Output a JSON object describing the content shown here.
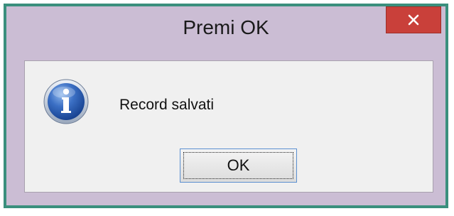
{
  "dialog": {
    "title": "Premi OK",
    "message": "Record salvati",
    "ok_label": "OK",
    "icon": "info-icon",
    "close_icon": "close-icon"
  },
  "colors": {
    "frame_border": "#3a8f7d",
    "titlebar_bg": "#cbbdd4",
    "close_button": "#c9403a",
    "client_bg": "#f0f0f0",
    "button_focus_border": "#5a8fd0"
  }
}
